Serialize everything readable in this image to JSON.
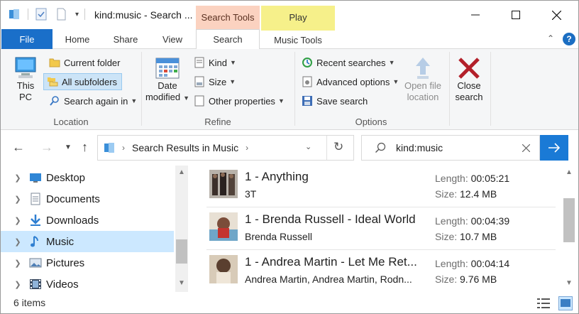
{
  "window": {
    "title": "kind:music - Search ...",
    "context_tabs": {
      "search_tools": "Search Tools",
      "play": "Play"
    }
  },
  "ribbon_tabs": {
    "file": "File",
    "home": "Home",
    "share": "Share",
    "view": "View",
    "search": "Search",
    "music_tools": "Music Tools"
  },
  "ribbon": {
    "location": {
      "label": "Location",
      "this_pc": [
        "This",
        "PC"
      ],
      "current_folder": "Current folder",
      "all_subfolders": "All subfolders",
      "search_again_in": "Search again in"
    },
    "refine": {
      "label": "Refine",
      "date_modified": [
        "Date",
        "modified"
      ],
      "kind": "Kind",
      "size": "Size",
      "other_properties": "Other properties"
    },
    "options": {
      "label": "Options",
      "recent_searches": "Recent searches",
      "advanced_options": "Advanced options",
      "save_search": "Save search",
      "open_file_location": [
        "Open file",
        "location"
      ]
    },
    "close_search": [
      "Close",
      "search"
    ]
  },
  "address": {
    "path": "Search Results in Music",
    "search_query": "kind:music"
  },
  "nav_pane": {
    "items": [
      {
        "label": "Desktop",
        "icon": "desktop-icon"
      },
      {
        "label": "Documents",
        "icon": "documents-icon"
      },
      {
        "label": "Downloads",
        "icon": "downloads-icon"
      },
      {
        "label": "Music",
        "icon": "music-icon",
        "selected": true
      },
      {
        "label": "Pictures",
        "icon": "pictures-icon"
      },
      {
        "label": "Videos",
        "icon": "videos-icon"
      }
    ]
  },
  "results": {
    "length_label": "Length:",
    "size_label": "Size:",
    "items": [
      {
        "name": "1 - Anything",
        "artist": "3T",
        "length": "00:05:21",
        "size": "12.4 MB"
      },
      {
        "name": "1 - Brenda Russell - Ideal World",
        "artist": "Brenda Russell",
        "length": "00:04:39",
        "size": "10.7 MB"
      },
      {
        "name": "1 - Andrea Martin - Let Me Ret...",
        "artist": "Andrea Martin, Andrea Martin, Rodn...",
        "length": "00:04:14",
        "size": "9.76 MB"
      }
    ]
  },
  "status": {
    "item_count": "6 items"
  },
  "colors": {
    "accent": "#1a6fc9",
    "search_tools": "#fbd2c0",
    "play": "#f6f08a",
    "selection": "#cce8ff"
  }
}
